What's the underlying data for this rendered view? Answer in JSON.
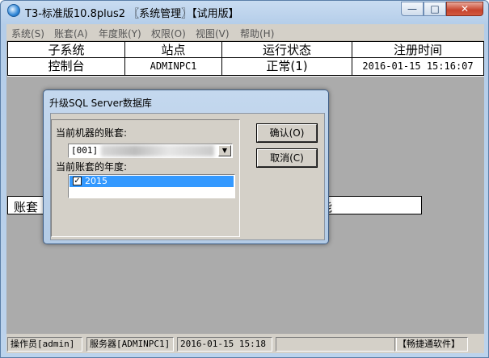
{
  "window": {
    "title": "T3-标准版10.8plus2 〖系统管理〗【试用版】",
    "controls": {
      "minimize": "—",
      "maximize": "□",
      "close": "✕"
    }
  },
  "menu": [
    "系统(S)",
    "账套(A)",
    "年度账(Y)",
    "权限(O)",
    "视图(V)",
    "帮助(H)"
  ],
  "table": {
    "headers": [
      "子系统",
      "站点",
      "运行状态",
      "注册时间"
    ],
    "rows": [
      [
        "控制台",
        "ADMINPC1",
        "正常(1)",
        "2016-01-15 15:16:07"
      ]
    ]
  },
  "lower_panel": {
    "left_text": "账套",
    "right_text": "能"
  },
  "dialog": {
    "title": "升级SQL Server数据库",
    "label_machine_accounts": "当前机器的账套:",
    "combo_value": "[001]",
    "label_account_year": "当前账套的年度:",
    "years": [
      {
        "label": "2015",
        "checked": true
      }
    ],
    "ok_button": "确认(O)",
    "cancel_button": "取消(C)"
  },
  "statusbar": {
    "operator": "操作员[admin]",
    "server": "服务器[ADMINPC1]",
    "datetime": "2016-01-15 15:18",
    "company": "【畅捷通软件】"
  }
}
